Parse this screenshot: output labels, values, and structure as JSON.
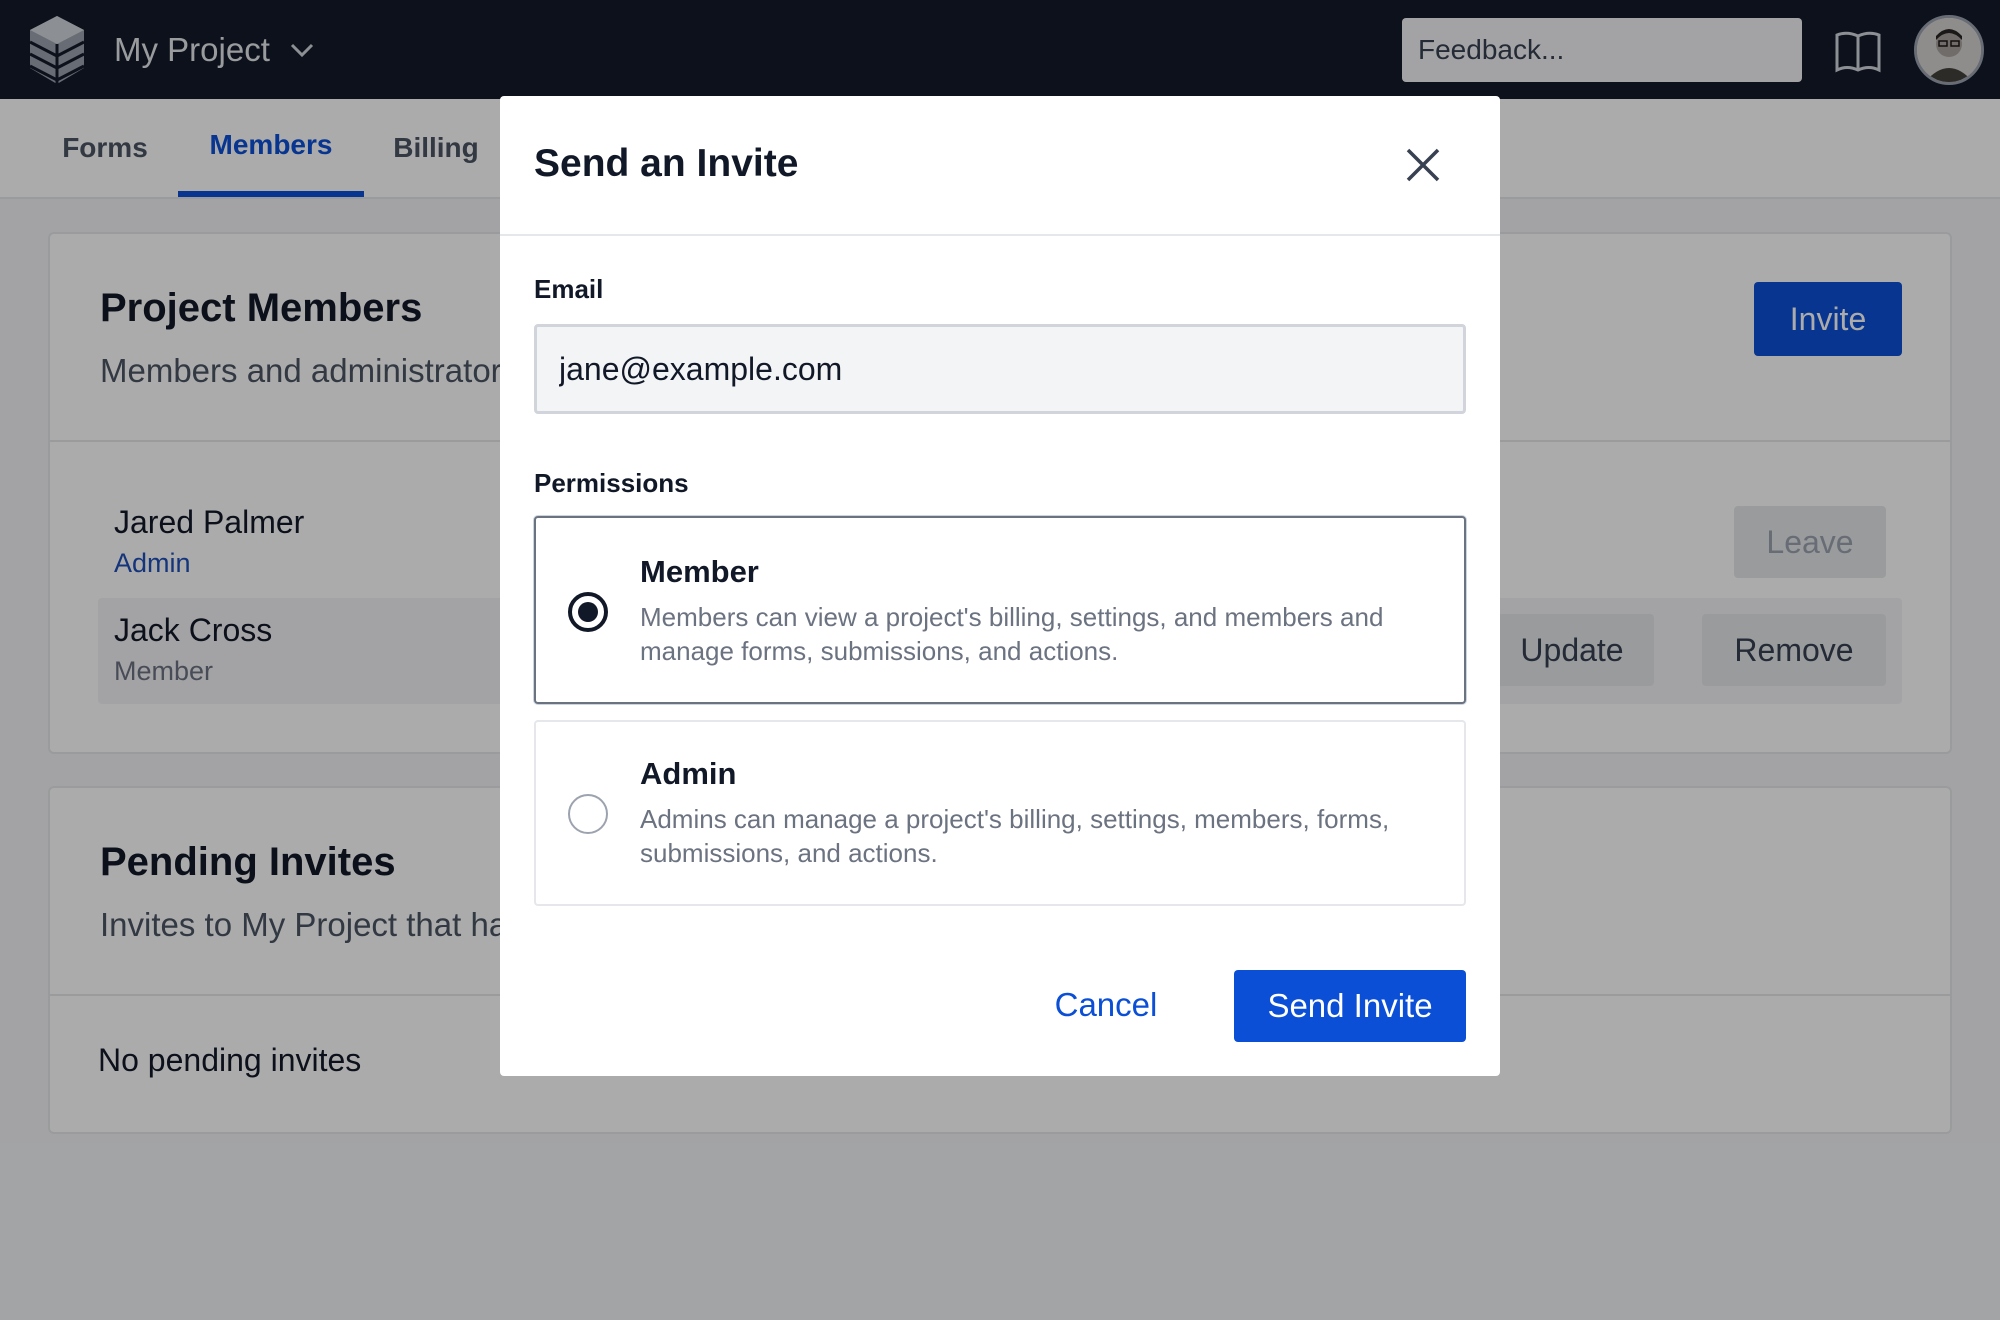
{
  "header": {
    "project_name": "My Project",
    "feedback_placeholder": "Feedback..."
  },
  "tabs": [
    {
      "label": "Forms",
      "active": false
    },
    {
      "label": "Members",
      "active": true
    },
    {
      "label": "Billing",
      "active": false
    }
  ],
  "members_card": {
    "title": "Project Members",
    "subtitle": "Members and administrators",
    "invite_label": "Invite",
    "members": [
      {
        "name": "Jared Palmer",
        "role": "Admin",
        "action": "Leave"
      },
      {
        "name": "Jack Cross",
        "role": "Member",
        "actions": [
          "Update",
          "Remove"
        ]
      }
    ]
  },
  "invites_card": {
    "title": "Pending Invites",
    "subtitle": "Invites to My Project that ha",
    "empty_text": "No pending invites"
  },
  "modal": {
    "title": "Send an Invite",
    "email_label": "Email",
    "email_value": "jane@example.com",
    "permissions_label": "Permissions",
    "options": [
      {
        "title": "Member",
        "description": "Members can view a project's billing, settings, and members and manage forms, submissions, and actions.",
        "selected": true
      },
      {
        "title": "Admin",
        "description": "Admins can manage a project's billing, settings, members, forms, submissions, and actions.",
        "selected": false
      }
    ],
    "cancel_label": "Cancel",
    "submit_label": "Send Invite"
  },
  "colors": {
    "topbar": "#121a29",
    "accent": "#0b4fd6",
    "role_admin": "#1e4fb8",
    "role_member": "#6b7280"
  }
}
